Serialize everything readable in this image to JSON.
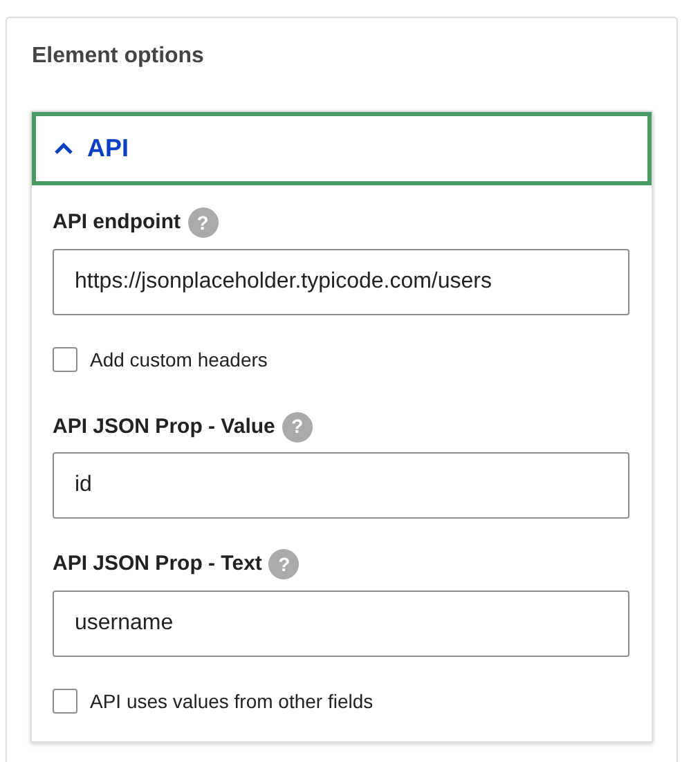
{
  "panel": {
    "title": "Element options"
  },
  "section": {
    "title": "API",
    "expanded": true,
    "items": [
      {
        "kind": "text",
        "label": "API endpoint",
        "help": "?",
        "value": "https://jsonplaceholder.typicode.com/users"
      },
      {
        "kind": "checkbox",
        "label": "Add custom headers",
        "checked": false
      },
      {
        "kind": "text",
        "label": "API JSON Prop - Value",
        "help": "?",
        "value": "id"
      },
      {
        "kind": "text",
        "label": "API JSON Prop - Text",
        "help": "?",
        "value": "username"
      },
      {
        "kind": "checkbox",
        "label": "API uses values from other fields",
        "checked": false
      }
    ]
  }
}
